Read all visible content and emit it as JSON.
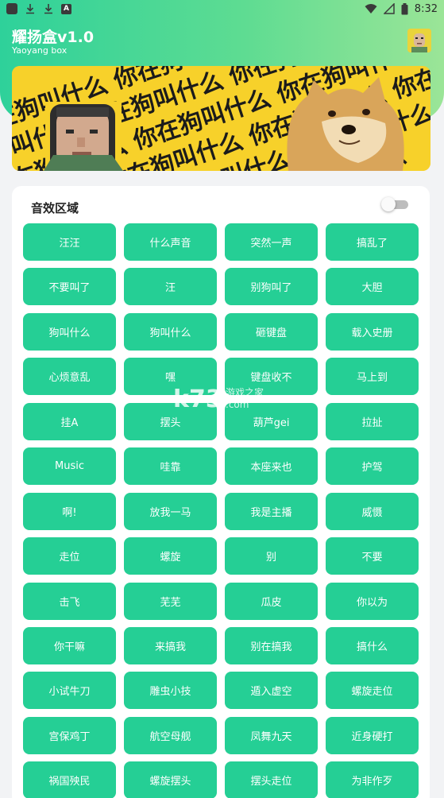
{
  "status_bar": {
    "time": "8:32",
    "icons": [
      "app-square-icon",
      "download-icon",
      "download-icon",
      "font-a-icon",
      "wifi-icon",
      "signal-icon",
      "battery-icon"
    ]
  },
  "app": {
    "title": "耀扬盒v1.0",
    "subtitle": "Yaoyang box",
    "colors": {
      "accent": "#25cf95",
      "header_start": "#2ed19a",
      "header_end": "#9be597"
    }
  },
  "banner": {
    "text": "你在狗叫什么"
  },
  "sound_panel": {
    "title": "音效区域",
    "toggle_on": false,
    "buttons": [
      "汪汪",
      "什么声音",
      "突然一声",
      "搞乱了",
      "不要叫了",
      "汪",
      "别狗叫了",
      "大胆",
      "狗叫什么",
      "狗叫什么",
      "砸键盘",
      "载入史册",
      "心烦意乱",
      "嘿",
      "键盘收不",
      "马上到",
      "挂A",
      "摆头",
      "葫芦gei",
      "拉扯",
      "Music",
      "哇靠",
      "本座来也",
      "护驾",
      "啊!",
      "放我一马",
      "我是主播",
      "威慑",
      "走位",
      "螺旋",
      "别",
      "不要",
      "击飞",
      "芜芜",
      "瓜皮",
      "你以为",
      "你干嘛",
      "来搞我",
      "别在搞我",
      "搞什么",
      "小试牛刀",
      "雕虫小技",
      "遁入虚空",
      "螺旋走位",
      "宫保鸡丁",
      "航空母舰",
      "凤舞九天",
      "近身硬打",
      "祸国殃民",
      "螺旋摆头",
      "摆头走位",
      "为非作歹"
    ]
  },
  "watermark": {
    "brand": "k73",
    "text": "游戏之家",
    "url": ".com"
  }
}
